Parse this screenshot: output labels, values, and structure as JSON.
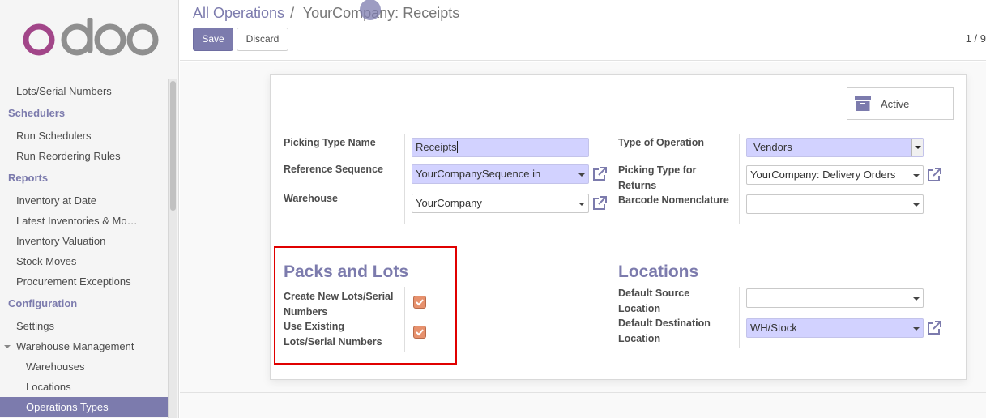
{
  "app": {
    "logo_text": "odoo"
  },
  "sidebar": {
    "items": [
      {
        "label": "Lots/Serial Numbers",
        "kind": "item"
      },
      {
        "label": "Schedulers",
        "kind": "section"
      },
      {
        "label": "Run Schedulers",
        "kind": "item"
      },
      {
        "label": "Run Reordering Rules",
        "kind": "item"
      },
      {
        "label": "Reports",
        "kind": "section"
      },
      {
        "label": "Inventory at Date",
        "kind": "item"
      },
      {
        "label": "Latest Inventories & Mo…",
        "kind": "item"
      },
      {
        "label": "Inventory Valuation",
        "kind": "item"
      },
      {
        "label": "Stock Moves",
        "kind": "item"
      },
      {
        "label": "Procurement Exceptions",
        "kind": "item"
      },
      {
        "label": "Configuration",
        "kind": "section"
      },
      {
        "label": "Settings",
        "kind": "item"
      },
      {
        "label": "Warehouse Management",
        "kind": "item"
      },
      {
        "label": "Warehouses",
        "kind": "subitem"
      },
      {
        "label": "Locations",
        "kind": "subitem"
      },
      {
        "label": "Operations Types",
        "kind": "subitem"
      }
    ]
  },
  "header": {
    "breadcrumb_parent": "All Operations",
    "breadcrumb_sep": "/",
    "breadcrumb_current": "YourCompany: Receipts",
    "save_label": "Save",
    "discard_label": "Discard",
    "pager": "1 / 9"
  },
  "form": {
    "active_label": "Active",
    "picking_type_name": {
      "label": "Picking Type Name",
      "value": "Receipts"
    },
    "reference_sequence": {
      "label": "Reference Sequence",
      "value": "YourCompanySequence in"
    },
    "warehouse": {
      "label": "Warehouse",
      "value": "YourCompany"
    },
    "type_of_operation": {
      "label": "Type of Operation",
      "value": "Vendors"
    },
    "return_type": {
      "label": "Picking Type for Returns",
      "value": "YourCompany: Delivery Orders"
    },
    "barcode_nomenclature": {
      "label": "Barcode Nomenclature",
      "value": ""
    },
    "packs_and_lots": {
      "title": "Packs and Lots",
      "create_new": {
        "label": "Create New Lots/Serial Numbers",
        "checked": true
      },
      "use_existing": {
        "label": "Use Existing Lots/Serial Numbers",
        "checked": true
      }
    },
    "locations": {
      "title": "Locations",
      "default_source": {
        "label": "Default Source Location",
        "value": ""
      },
      "default_destination": {
        "label": "Default Destination Location",
        "value": "WH/Stock"
      }
    }
  },
  "colors": {
    "brand": "#7c7bad",
    "logo_purple": "#a24689",
    "logo_grey": "#8f8f8f",
    "required_field": "#d2d2ff",
    "checkbox": "#e7916d",
    "highlight_box": "#e00000"
  }
}
